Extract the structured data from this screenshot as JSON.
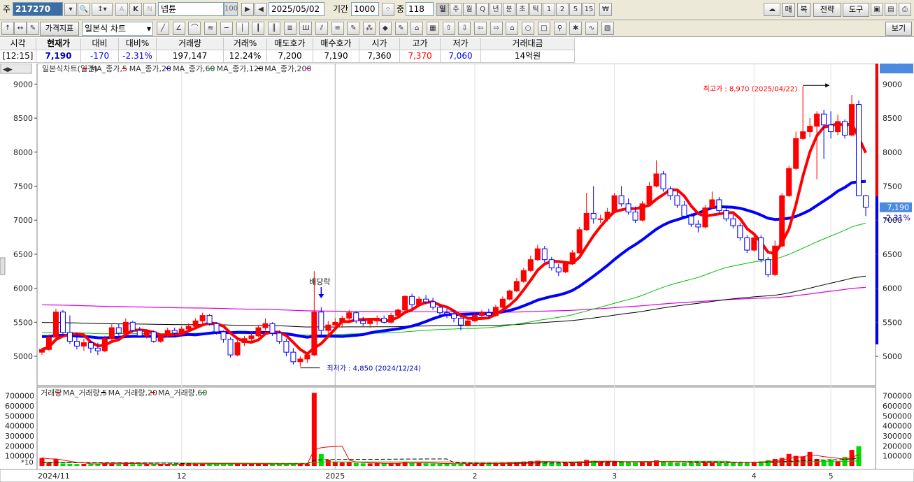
{
  "toolbar1": {
    "code_label": "주",
    "code_value": "217270",
    "stock_name": "넵튠",
    "zoom_value": "100",
    "date_value": "2025/05/02",
    "period_label": "기간",
    "period_value": "1000",
    "count_label": "중",
    "count_value": "118",
    "timeframes": [
      "일",
      "주",
      "월",
      "Q",
      "년",
      "분",
      "초",
      "틱",
      "1",
      "2",
      "5",
      "15"
    ],
    "right_buttons": [
      "매",
      "복",
      "전략",
      "도구"
    ]
  },
  "toolbar2": {
    "chart_type": "가격지표",
    "style_select": "일본식 차트",
    "view_button": "보기"
  },
  "quote": {
    "headers": [
      "시각",
      "현재가",
      "대비",
      "대비%",
      "거래량",
      "거래%",
      "매도호가",
      "매수호가",
      "시가",
      "고가",
      "저가",
      "거래대금"
    ],
    "values": [
      "[12:15]",
      "7,190",
      "-170",
      "-2.31%",
      "197,147",
      "12.24%",
      "7,200",
      "7,190",
      "7,360",
      "7,370",
      "7,060",
      "14억원"
    ]
  },
  "chart_data": {
    "type": "candlestick",
    "price_legend": [
      "일본식차트(일간)",
      "MA_종가,5",
      "MA_종가,20",
      "MA_종가,60",
      "MA_종가,120",
      "MA_종가,200"
    ],
    "volume_legend": [
      "거래량",
      "MA_거래량,5",
      "MA_거래량,20",
      "MA_거래량,60"
    ],
    "x_labels": [
      "2024/11",
      "12",
      "2025",
      "2",
      "3",
      "4",
      "5"
    ],
    "y_ticks": [
      5000,
      5500,
      6000,
      6500,
      7000,
      7500,
      8000,
      8500,
      9000
    ],
    "ylim": [
      4600,
      9250
    ],
    "vol_ticks": [
      100000,
      200000,
      300000,
      400000,
      500000,
      600000,
      700000
    ],
    "vol_ylim": [
      0,
      740000
    ],
    "vol_multiplier": "*10",
    "current_price": "7,190",
    "current_change": "-2.31%",
    "current_volume": "197,147",
    "current_volume_pct": "12.24%",
    "annotations": {
      "high": "최고가 : 8,970 (2025/04/22)",
      "low": "최저가 : 4,850 (2024/12/24)",
      "dividend": "배당락"
    },
    "colors": {
      "up": "#ff0000",
      "down": "#0000ff",
      "ma5": "#ff0000",
      "ma20": "#0000ff",
      "ma60": "#00c000",
      "ma120": "#000000",
      "ma200": "#e000e0"
    },
    "candles": [
      [
        5060,
        5120,
        5020,
        5100
      ],
      [
        5100,
        5320,
        5080,
        5280
      ],
      [
        5280,
        5700,
        5250,
        5650
      ],
      [
        5650,
        5680,
        5300,
        5350
      ],
      [
        5350,
        5600,
        5180,
        5220
      ],
      [
        5220,
        5350,
        5100,
        5150
      ],
      [
        5150,
        5260,
        5080,
        5200
      ],
      [
        5200,
        5230,
        5050,
        5120
      ],
      [
        5120,
        5200,
        5020,
        5080
      ],
      [
        5080,
        5300,
        5060,
        5260
      ],
      [
        5260,
        5480,
        5240,
        5420
      ],
      [
        5420,
        5480,
        5300,
        5340
      ],
      [
        5340,
        5560,
        5320,
        5500
      ],
      [
        5500,
        5520,
        5350,
        5380
      ],
      [
        5380,
        5430,
        5280,
        5300
      ],
      [
        5300,
        5400,
        5260,
        5360
      ],
      [
        5360,
        5380,
        5200,
        5220
      ],
      [
        5220,
        5330,
        5200,
        5300
      ],
      [
        5300,
        5420,
        5280,
        5380
      ],
      [
        5380,
        5420,
        5300,
        5340
      ],
      [
        5340,
        5440,
        5320,
        5400
      ],
      [
        5400,
        5480,
        5380,
        5440
      ],
      [
        5440,
        5560,
        5400,
        5520
      ],
      [
        5520,
        5640,
        5480,
        5600
      ],
      [
        5600,
        5620,
        5450,
        5480
      ],
      [
        5480,
        5500,
        5320,
        5360
      ],
      [
        5360,
        5380,
        5200,
        5250
      ],
      [
        5250,
        5280,
        4980,
        5020
      ],
      [
        5020,
        5250,
        5000,
        5200
      ],
      [
        5200,
        5300,
        5150,
        5260
      ],
      [
        5260,
        5350,
        5200,
        5300
      ],
      [
        5300,
        5460,
        5280,
        5420
      ],
      [
        5420,
        5560,
        5380,
        5480
      ],
      [
        5480,
        5500,
        5300,
        5340
      ],
      [
        5340,
        5380,
        5180,
        5220
      ],
      [
        5220,
        5260,
        5000,
        5060
      ],
      [
        5060,
        5120,
        4880,
        4920
      ],
      [
        4920,
        5000,
        4850,
        4960
      ],
      [
        4960,
        5050,
        4900,
        5020
      ],
      [
        5020,
        6250,
        5000,
        5650
      ],
      [
        5650,
        5720,
        5280,
        5380
      ],
      [
        5380,
        5520,
        5300,
        5460
      ],
      [
        5460,
        5560,
        5400,
        5500
      ],
      [
        5500,
        5600,
        5420,
        5560
      ],
      [
        5560,
        5680,
        5500,
        5640
      ],
      [
        5640,
        5660,
        5480,
        5520
      ],
      [
        5520,
        5580,
        5440,
        5480
      ],
      [
        5480,
        5560,
        5420,
        5520
      ],
      [
        5520,
        5600,
        5460,
        5560
      ],
      [
        5560,
        5600,
        5480,
        5500
      ],
      [
        5500,
        5640,
        5480,
        5600
      ],
      [
        5600,
        5700,
        5560,
        5680
      ],
      [
        5680,
        5900,
        5650,
        5880
      ],
      [
        5880,
        5920,
        5700,
        5760
      ],
      [
        5760,
        5880,
        5720,
        5840
      ],
      [
        5840,
        5900,
        5760,
        5800
      ],
      [
        5800,
        5860,
        5680,
        5720
      ],
      [
        5720,
        5760,
        5600,
        5640
      ],
      [
        5640,
        5700,
        5560,
        5620
      ],
      [
        5620,
        5680,
        5500,
        5560
      ],
      [
        5560,
        5600,
        5380,
        5460
      ],
      [
        5460,
        5560,
        5440,
        5520
      ],
      [
        5520,
        5640,
        5500,
        5600
      ],
      [
        5600,
        5680,
        5540,
        5640
      ],
      [
        5640,
        5700,
        5560,
        5600
      ],
      [
        5600,
        5760,
        5580,
        5720
      ],
      [
        5720,
        5880,
        5700,
        5840
      ],
      [
        5840,
        5980,
        5820,
        5960
      ],
      [
        5960,
        6150,
        5940,
        6100
      ],
      [
        6100,
        6300,
        6080,
        6260
      ],
      [
        6260,
        6480,
        6240,
        6420
      ],
      [
        6420,
        6640,
        6400,
        6580
      ],
      [
        6580,
        6620,
        6380,
        6420
      ],
      [
        6420,
        6460,
        6260,
        6300
      ],
      [
        6300,
        6360,
        6180,
        6240
      ],
      [
        6240,
        6400,
        6220,
        6360
      ],
      [
        6360,
        6560,
        6340,
        6520
      ],
      [
        6520,
        6900,
        6500,
        6860
      ],
      [
        6860,
        7400,
        6840,
        7100
      ],
      [
        7100,
        7500,
        6950,
        7020
      ],
      [
        7020,
        7080,
        6960,
        7020
      ],
      [
        7020,
        7180,
        6980,
        7120
      ],
      [
        7120,
        7400,
        7100,
        7360
      ],
      [
        7360,
        7500,
        7200,
        7240
      ],
      [
        7240,
        7320,
        7080,
        7120
      ],
      [
        7120,
        7200,
        6960,
        7000
      ],
      [
        7000,
        7280,
        6980,
        7240
      ],
      [
        7240,
        7560,
        7220,
        7500
      ],
      [
        7500,
        7880,
        7480,
        7680
      ],
      [
        7680,
        7720,
        7420,
        7460
      ],
      [
        7460,
        7500,
        7300,
        7360
      ],
      [
        7360,
        7420,
        7180,
        7220
      ],
      [
        7220,
        7280,
        7020,
        7060
      ],
      [
        7060,
        7100,
        6900,
        6940
      ],
      [
        6940,
        7000,
        6820,
        6900
      ],
      [
        6900,
        7220,
        6880,
        7180
      ],
      [
        7180,
        7420,
        7160,
        7300
      ],
      [
        7300,
        7340,
        7100,
        7140
      ],
      [
        7140,
        7180,
        6980,
        7020
      ],
      [
        7020,
        7080,
        6880,
        6920
      ],
      [
        6920,
        6960,
        6700,
        6740
      ],
      [
        6740,
        6780,
        6520,
        6560
      ],
      [
        6560,
        6800,
        6540,
        6740
      ],
      [
        6740,
        6780,
        6380,
        6420
      ],
      [
        6420,
        6460,
        6160,
        6200
      ],
      [
        6200,
        6700,
        6180,
        6620
      ],
      [
        6620,
        7400,
        6600,
        7360
      ],
      [
        7360,
        7800,
        7340,
        7760
      ],
      [
        7760,
        8300,
        7740,
        8200
      ],
      [
        8200,
        8970,
        8180,
        8300
      ],
      [
        8300,
        8500,
        8220,
        8380
      ],
      [
        8380,
        8600,
        7600,
        8560
      ],
      [
        8560,
        8620,
        7900,
        8400
      ],
      [
        8400,
        8600,
        8200,
        8300
      ],
      [
        8300,
        8550,
        8250,
        8450
      ],
      [
        8450,
        8480,
        8200,
        8250
      ],
      [
        8250,
        8840,
        8230,
        8700
      ],
      [
        8700,
        8760,
        7620,
        7360
      ],
      [
        7360,
        7370,
        7060,
        7190
      ]
    ],
    "volumes": [
      80000,
      40000,
      70000,
      25000,
      22000,
      20000,
      21000,
      19000,
      18000,
      30000,
      26000,
      20000,
      28000,
      19000,
      17000,
      18000,
      16000,
      17000,
      20000,
      18000,
      19000,
      20000,
      24000,
      26000,
      22000,
      18000,
      17000,
      30000,
      20000,
      18000,
      19000,
      22000,
      24000,
      18000,
      17000,
      20000,
      22000,
      18000,
      20000,
      730000,
      120000,
      60000,
      40000,
      35000,
      38000,
      30000,
      26000,
      25000,
      28000,
      24000,
      26000,
      28000,
      40000,
      30000,
      28000,
      26000,
      24000,
      22000,
      21000,
      20000,
      24000,
      22000,
      25000,
      24000,
      22000,
      26000,
      30000,
      34000,
      40000,
      44000,
      48000,
      52000,
      40000,
      34000,
      30000,
      32000,
      38000,
      46000,
      60000,
      52000,
      40000,
      42000,
      46000,
      40000,
      36000,
      34000,
      38000,
      44000,
      56000,
      42000,
      36000,
      32000,
      30000,
      30000,
      34000,
      40000,
      36000,
      32000,
      30000,
      34000,
      38000,
      36000,
      40000,
      46000,
      58000,
      70000,
      80000,
      120000,
      100000,
      95000,
      140000,
      70000,
      60000,
      65000,
      50000,
      90000,
      160000,
      197147
    ]
  }
}
